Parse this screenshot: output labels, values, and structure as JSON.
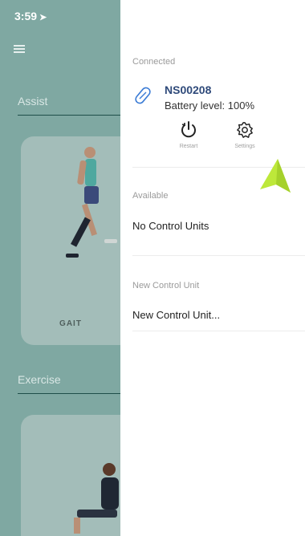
{
  "status_bar": {
    "time": "3:59"
  },
  "background": {
    "section_assist": "Assist",
    "card_gait_label": "GAIT",
    "section_exercise": "Exercise"
  },
  "drawer": {
    "connected_header": "Connected",
    "device": {
      "name": "NS00208",
      "battery": "Battery level: 100%"
    },
    "actions": {
      "restart_label": "Restart",
      "settings_label": "Settings"
    },
    "available_header": "Available",
    "available_empty": "No Control Units",
    "new_unit_header": "New Control Unit",
    "new_unit_action": "New Control Unit..."
  },
  "colors": {
    "accent_arrow": "#bde83a",
    "device_name": "#2f4a7a",
    "background_teal": "#7fa8a2"
  },
  "icons": [
    "location-arrow-icon",
    "menu-icon",
    "sensor-icon",
    "restart-icon",
    "settings-gear-icon",
    "pointer-arrow-icon"
  ]
}
